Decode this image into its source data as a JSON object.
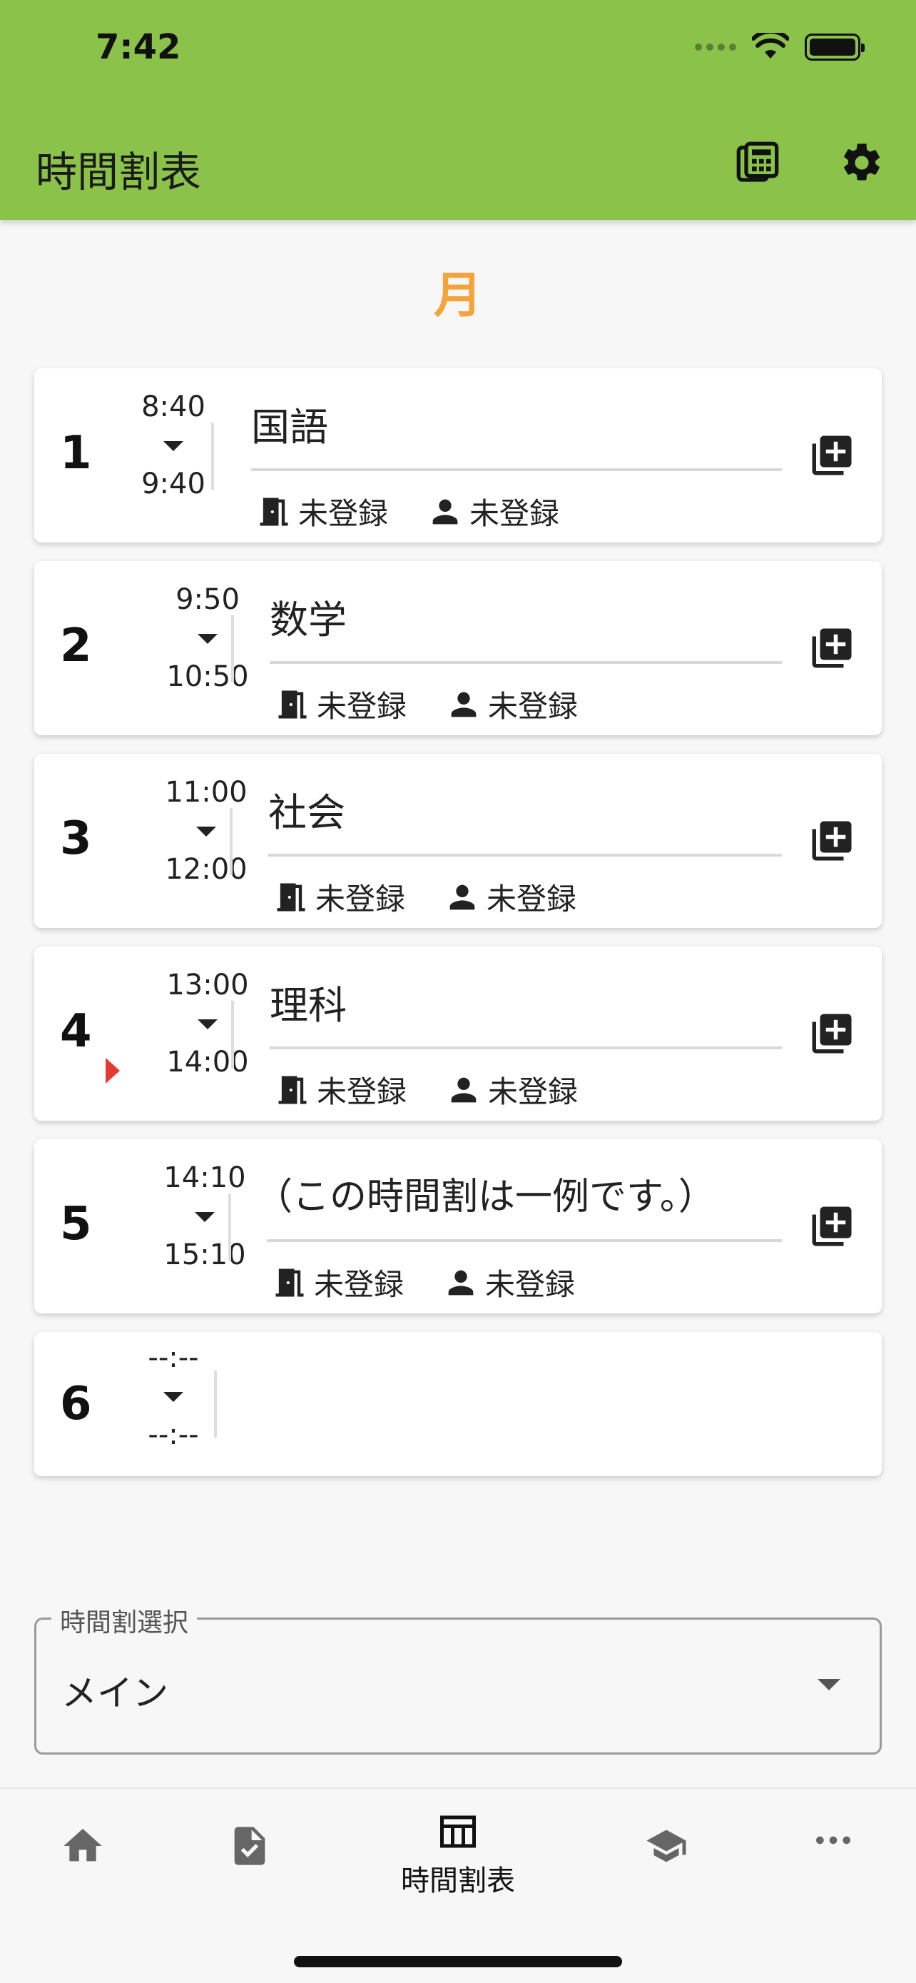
{
  "status_bar": {
    "time": "7:42"
  },
  "app_bar": {
    "title": "時間割表",
    "calculator_icon": "calculator-icon",
    "settings_icon": "gear-icon"
  },
  "day": "月",
  "periods": [
    {
      "number": "1",
      "start": "8:40",
      "end": "9:40",
      "subject": "国語",
      "room": "未登録",
      "teacher": "未登録"
    },
    {
      "number": "2",
      "start": "9:50",
      "end": "10:50",
      "subject": "数学",
      "room": "未登録",
      "teacher": "未登録"
    },
    {
      "number": "3",
      "start": "11:00",
      "end": "12:00",
      "subject": "社会",
      "room": "未登録",
      "teacher": "未登録"
    },
    {
      "number": "4",
      "start": "13:00",
      "end": "14:00",
      "subject": "理科",
      "room": "未登録",
      "teacher": "未登録",
      "current": true
    },
    {
      "number": "5",
      "start": "14:10",
      "end": "15:10",
      "subject": "（この時間割は一例です。）",
      "room": "未登録",
      "teacher": "未登録"
    },
    {
      "number": "6",
      "start": "--:--",
      "end": "--:--",
      "subject": ""
    }
  ],
  "timetable_select": {
    "label": "時間割選択",
    "value": "メイン"
  },
  "bottom_nav": {
    "items": [
      {
        "icon": "home-icon",
        "label": ""
      },
      {
        "icon": "task-check-icon",
        "label": ""
      },
      {
        "icon": "table-icon",
        "label": "時間割表",
        "active": true
      },
      {
        "icon": "graduation-cap-icon",
        "label": ""
      },
      {
        "icon": "more-horizontal-icon",
        "label": ""
      }
    ]
  },
  "colors": {
    "app_bar": "#8bc34a",
    "day_label": "#f5a43b",
    "now_marker": "#e53935"
  }
}
